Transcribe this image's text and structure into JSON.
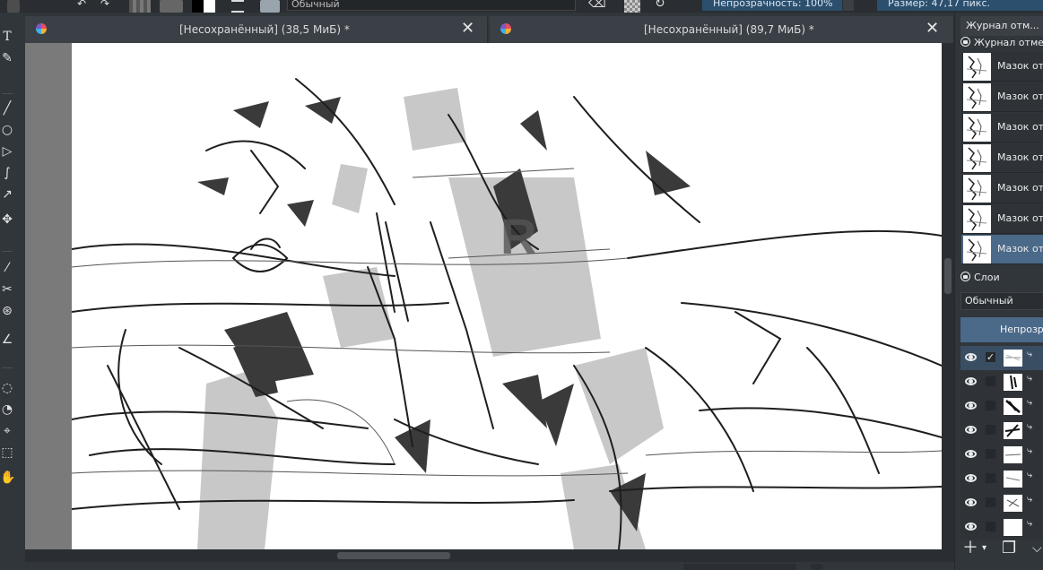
{
  "toolbar": {
    "blend_mode": "Обычный",
    "opacity": "Непрозрачность: 100%",
    "size": "Размер: 47,17 пикс."
  },
  "documents": [
    {
      "title": "[Несохранённый]  (38,5 МиБ) *",
      "active": true
    },
    {
      "title": "[Несохранённый]  (89,7 МиБ) *",
      "active": false
    }
  ],
  "tools": [
    "text-tool",
    "edit-shapes-tool",
    "line-tool",
    "ellipse-tool",
    "polygon-tool",
    "bezier-tool",
    "dynamic-brush-tool",
    "move-tool",
    "color-picker-tool",
    "crop-tool",
    "assistant-tool",
    "measure-tool",
    "ellipse-select-tool",
    "freehand-select-tool",
    "magnetic-select-tool",
    "bezier-select-tool",
    "pan-tool"
  ],
  "history": {
    "tab_label": "Журнал отм...",
    "header": "Журнал отме...",
    "items": [
      {
        "label": "Мазок от"
      },
      {
        "label": "Мазок от"
      },
      {
        "label": "Мазок от"
      },
      {
        "label": "Мазок от"
      },
      {
        "label": "Мазок от"
      },
      {
        "label": "Мазок от"
      },
      {
        "label": "Мазок от",
        "selected": true
      }
    ]
  },
  "layers": {
    "header": "Слои",
    "blend_mode": "Обычный",
    "opacity_label": "Непрозра",
    "rows": [
      {
        "visible": true,
        "checked": true,
        "selected": true
      },
      {
        "visible": true,
        "checked": false
      },
      {
        "visible": true,
        "checked": false
      },
      {
        "visible": true,
        "checked": false
      },
      {
        "visible": true,
        "checked": false
      },
      {
        "visible": true,
        "checked": false
      },
      {
        "visible": true,
        "checked": false
      },
      {
        "visible": true,
        "checked": false
      }
    ],
    "check_glyph": "✓",
    "kind_glyph": "⤷"
  },
  "colors": {
    "accent": "#4b6988",
    "panel": "#31363b",
    "canvas_bg": "#7a7a7a"
  }
}
